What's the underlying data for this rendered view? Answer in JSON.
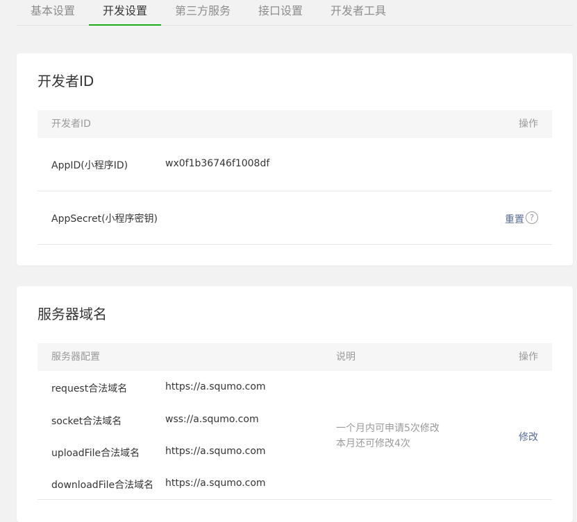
{
  "tabs": [
    {
      "label": "基本设置",
      "active": false
    },
    {
      "label": "开发设置",
      "active": true
    },
    {
      "label": "第三方服务",
      "active": false
    },
    {
      "label": "接口设置",
      "active": false
    },
    {
      "label": "开发者工具",
      "active": false
    }
  ],
  "developer": {
    "title": "开发者ID",
    "header_col1": "开发者ID",
    "header_action": "操作",
    "appid_label": "AppID(小程序ID)",
    "appid_value": "wx0f1b36746f1008df",
    "secret_label": "AppSecret(小程序密钥)",
    "secret_action": "重置",
    "help_icon": "?"
  },
  "server": {
    "title": "服务器域名",
    "header_col1": "服务器配置",
    "header_col2": "说明",
    "header_action": "操作",
    "rows": [
      {
        "label": "request合法域名",
        "value": "https://a.squmo.com"
      },
      {
        "label": "socket合法域名",
        "value": "wss://a.squmo.com"
      },
      {
        "label": "uploadFile合法域名",
        "value": "https://a.squmo.com"
      },
      {
        "label": "downloadFile合法域名",
        "value": "https://a.squmo.com"
      }
    ],
    "note_line1": "一个月内可申请5次修改",
    "note_line2": "本月还可修改4次",
    "modify_action": "修改"
  },
  "colors": {
    "accent": "#1aad19",
    "link": "#576b95"
  }
}
